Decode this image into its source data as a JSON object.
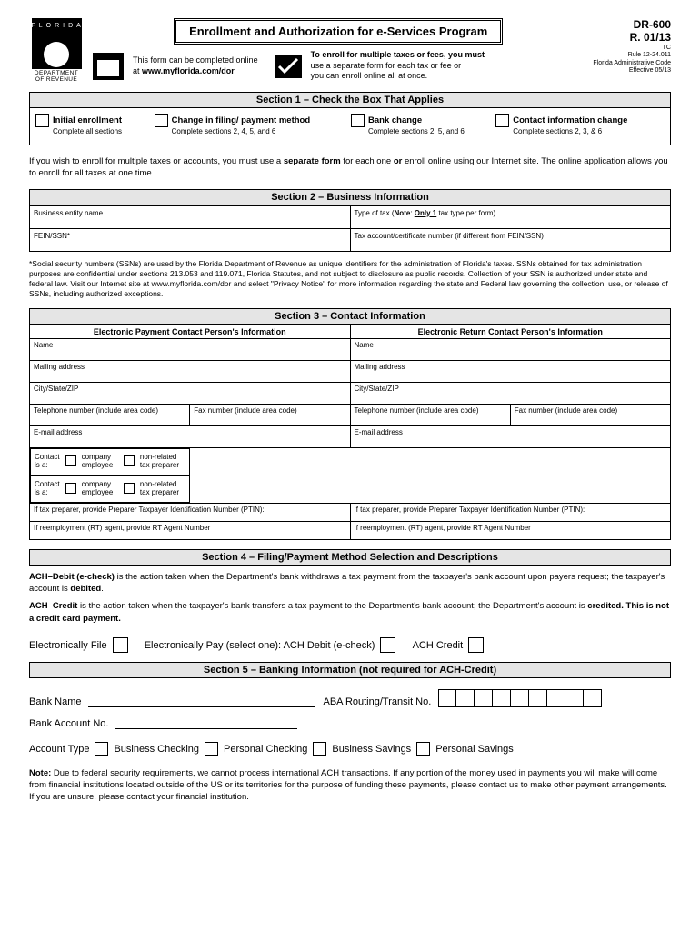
{
  "logo": {
    "word": "FLORIDA",
    "dept1": "DEPARTMENT",
    "dept2": "OF REVENUE"
  },
  "title": "Enrollment and Authorization for e-Services Program",
  "online": {
    "line1": "This form can be completed online",
    "line2": "at ",
    "url": "www.myflorida.com/dor"
  },
  "enroll": {
    "bold": "To enroll for multiple taxes or fees, you must",
    "rest1": "use a separate form for each tax or fee or",
    "rest2": "you can enroll online all at once."
  },
  "formnum": {
    "dr": "DR-600",
    "rev": "R. 01/13",
    "tc": "TC",
    "rule": "Rule 12-24.011",
    "code": "Florida Administrative Code",
    "eff": "Effective 05/13"
  },
  "sec1": {
    "head": "Section 1 – Check the Box That Applies",
    "opts": [
      {
        "label": "Initial enrollment",
        "sub": "Complete all sections"
      },
      {
        "label": "Change in filing/ payment method",
        "sub": "Complete sections 2, 4, 5, and 6"
      },
      {
        "label": "Bank change",
        "sub": "Complete sections 2, 5, and 6"
      },
      {
        "label": "Contact information change",
        "sub": "Complete sections 2, 3, & 6"
      }
    ]
  },
  "para1a": "If you wish to enroll for multiple taxes or accounts, you must use a ",
  "para1b": "separate form",
  "para1c": " for each one ",
  "para1d": "or",
  "para1e": " enroll online using our Internet site.  The online application allows you to enroll for all taxes at one time.",
  "sec2": {
    "head": "Section 2 – Business Information",
    "r1c1": "Business entity name",
    "r1c2": "Type of tax (Note: Only 1 tax type per form)",
    "r2c1": "FEIN/SSN*",
    "r2c2": "Tax account/certificate number (if different from FEIN/SSN)"
  },
  "ssnNote": "*Social security numbers (SSNs) are used by the Florida Department of Revenue as unique identifiers for the administration of Florida's taxes.  SSNs obtained for tax administration purposes are confidential under sections 213.053 and 119.071, Florida Statutes, and not subject to disclosure as public records.  Collection of your SSN is authorized under state and federal law.  Visit our Internet site at www.myflorida.com/dor and select \"Privacy Notice\" for more information regarding the state and Federal law governing the collection, use, or release of SSNs, including authorized exceptions.",
  "sec3": {
    "head": "Section 3 – Contact Information",
    "col1": "Electronic Payment Contact Person's Information",
    "col2": "Electronic Return Contact Person's Information",
    "fields": [
      "Name",
      "Mailing address",
      "City/State/ZIP",
      "Telephone number (include area code)",
      "Fax number (include area code)",
      "E-mail address"
    ],
    "contactIs": "Contact is a:",
    "emp": "company employee",
    "prep": "non-related tax preparer",
    "ptin": "If tax preparer, provide Preparer Taxpayer Identification Number (PTIN):",
    "rt": "If reemployment (RT) agent, provide RT Agent Number"
  },
  "sec4": {
    "head": "Section 4 – Filing/Payment Method Selection and Descriptions",
    "d1a": "ACH–Debit (e-check)",
    "d1b": " is the action taken when the Department's bank withdraws a tax payment from the taxpayer's bank account upon payers request; the taxpayer's account is ",
    "d1c": "debited",
    "d2a": "ACH–Credit",
    "d2b": " is the action taken when the taxpayer's bank transfers a tax payment to the Department's bank account; the Department's account is ",
    "d2c": "credited",
    "d2d": ".  This is not a credit card payment.",
    "efile": "Electronically File",
    "epay": "Electronically Pay (select one):   ACH Debit (e-check)",
    "achc": "ACH Credit"
  },
  "sec5": {
    "head": "Section 5 – Banking Information (not required for ACH-Credit)",
    "bank": "Bank Name",
    "aba": "ABA Routing/Transit No.",
    "acct": "Bank Account No.",
    "type": "Account Type",
    "opts": [
      "Business Checking",
      "Personal Checking",
      "Business Savings",
      "Personal Savings"
    ],
    "noteLabel": "Note:",
    "note": "  Due to federal security requirements, we cannot process international ACH transactions.  If any portion of the money used in payments you will make will come from financial institutions located outside of the US or its territories for the purpose of funding these payments, please contact us to make other payment arrangements. If you are unsure, please contact your financial institution."
  }
}
